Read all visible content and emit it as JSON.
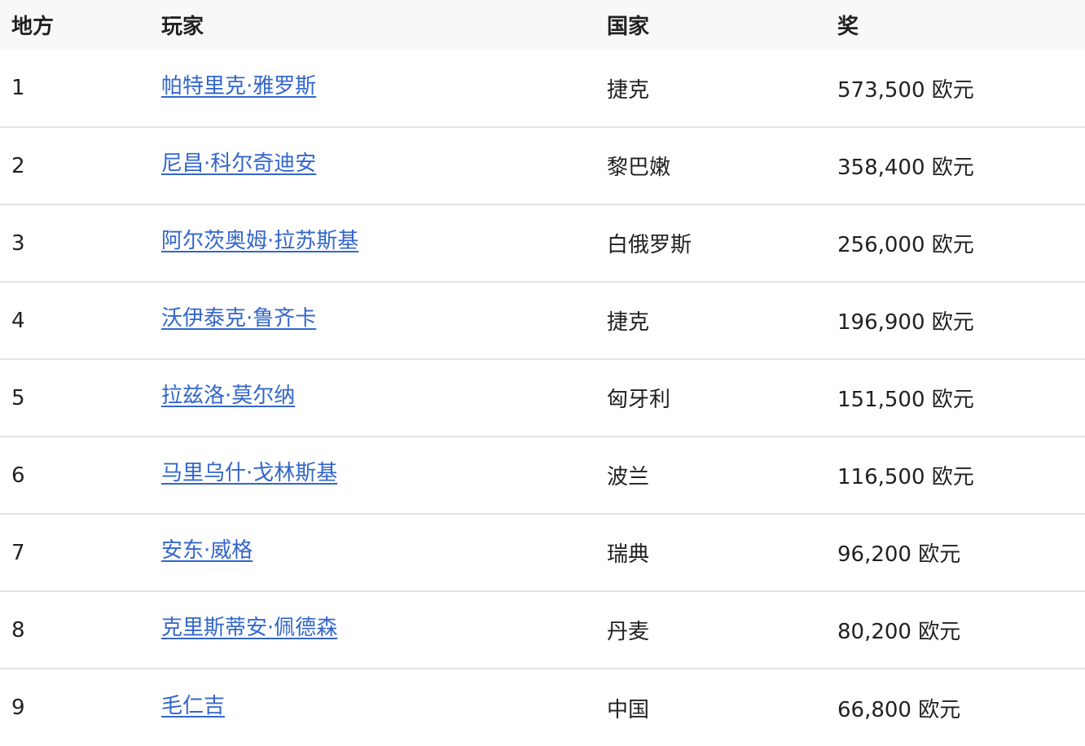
{
  "table": {
    "headers": {
      "place": "地方",
      "player": "玩家",
      "country": "国家",
      "prize": "奖"
    },
    "rows": [
      {
        "place": "1",
        "player": "帕特里克·雅罗斯",
        "country": "捷克",
        "prize": "573,500 欧元"
      },
      {
        "place": "2",
        "player": "尼昌·科尔奇迪安",
        "country": "黎巴嫩",
        "prize": "358,400 欧元"
      },
      {
        "place": "3",
        "player": "阿尔茨奥姆·拉苏斯基",
        "country": "白俄罗斯",
        "prize": "256,000 欧元"
      },
      {
        "place": "4",
        "player": "沃伊泰克·鲁齐卡",
        "country": "捷克",
        "prize": "196,900 欧元"
      },
      {
        "place": "5",
        "player": "拉兹洛·莫尔纳",
        "country": "匈牙利",
        "prize": "151,500 欧元"
      },
      {
        "place": "6",
        "player": "马里乌什·戈林斯基",
        "country": "波兰",
        "prize": "116,500 欧元"
      },
      {
        "place": "7",
        "player": "安东·威格",
        "country": "瑞典",
        "prize": "96,200 欧元"
      },
      {
        "place": "8",
        "player": "克里斯蒂安·佩德森",
        "country": "丹麦",
        "prize": "80,200 欧元"
      },
      {
        "place": "9",
        "player": "毛仁吉",
        "country": "中国",
        "prize": "66,800 欧元"
      }
    ]
  }
}
